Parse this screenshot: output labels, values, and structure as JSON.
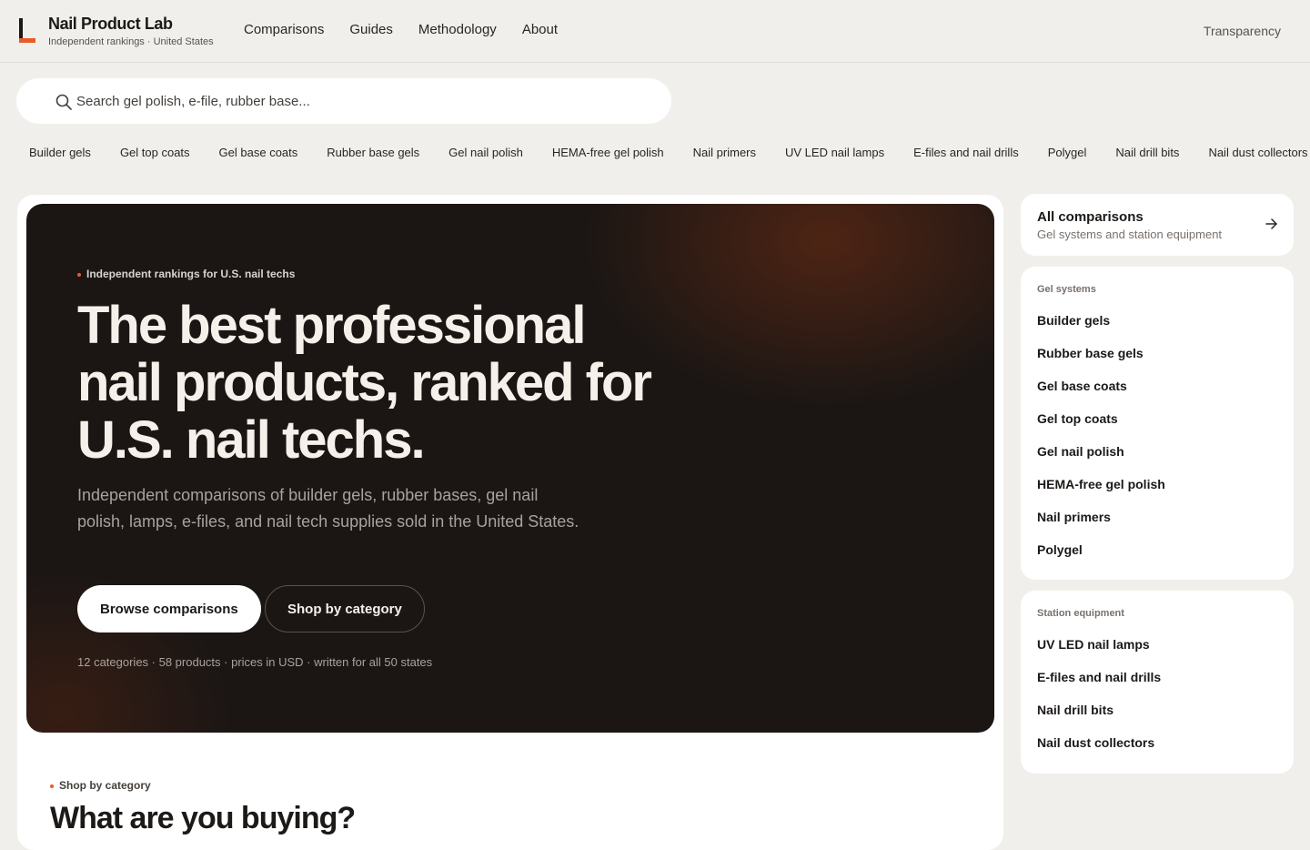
{
  "brand": {
    "name": "Nail Product Lab",
    "tagline": "Independent rankings · United States"
  },
  "nav": {
    "items": [
      {
        "label": "Comparisons"
      },
      {
        "label": "Guides"
      },
      {
        "label": "Methodology"
      },
      {
        "label": "About"
      }
    ],
    "transparency": "Transparency"
  },
  "search": {
    "placeholder": "Search gel polish, e-file, rubber base..."
  },
  "chips": [
    "Builder gels",
    "Gel top coats",
    "Gel base coats",
    "Rubber base gels",
    "Gel nail polish",
    "HEMA-free gel polish",
    "Nail primers",
    "UV LED nail lamps",
    "E-files and nail drills",
    "Polygel",
    "Nail drill bits",
    "Nail dust collectors"
  ],
  "hero": {
    "eyebrow": "Independent rankings for U.S. nail techs",
    "title": "The best professional nail products, ranked for U.S. nail techs.",
    "description": "Independent comparisons of builder gels, rubber bases, gel nail polish, lamps, e-files, and nail tech supplies sold in the United States.",
    "primary_button": "Browse comparisons",
    "secondary_button": "Shop by category",
    "meta": "12 categories · 58 products · prices in USD · written for all 50 states"
  },
  "section": {
    "eyebrow": "Shop by category",
    "title": "What are you buying?"
  },
  "sidebar": {
    "all": {
      "title": "All comparisons",
      "subtitle": "Gel systems and station equipment"
    },
    "gel": {
      "heading": "Gel systems",
      "items": [
        "Builder gels",
        "Rubber base gels",
        "Gel base coats",
        "Gel top coats",
        "Gel nail polish",
        "HEMA-free gel polish",
        "Nail primers",
        "Polygel"
      ]
    },
    "equipment": {
      "heading": "Station equipment",
      "items": [
        "UV LED nail lamps",
        "E-files and nail drills",
        "Nail drill bits",
        "Nail dust collectors"
      ]
    }
  },
  "colors": {
    "accent": "#ea5a2a",
    "hero_bg": "#1b1614",
    "page_bg": "#f1efeb"
  }
}
